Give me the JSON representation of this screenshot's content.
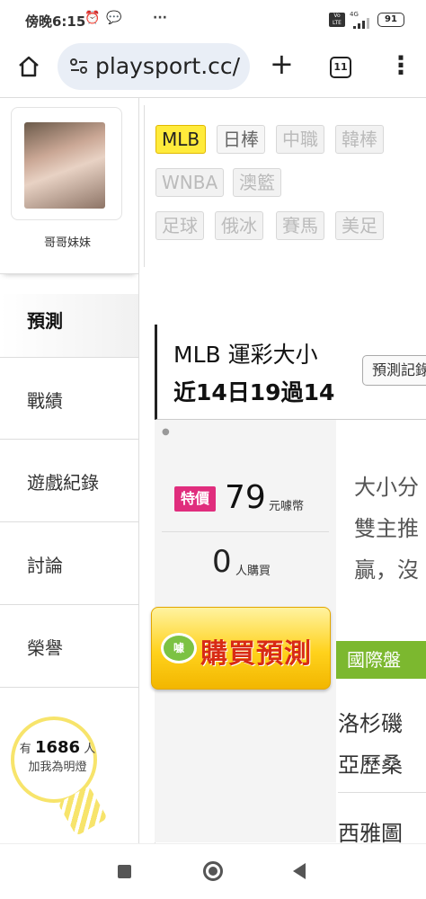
{
  "status_bar": {
    "time": "傍晚6:15",
    "alarm_icon": "alarm-clock-icon",
    "chat_icon": "chat-bubble-icon",
    "more": "···",
    "volte": "Vo LTE",
    "network": "4G",
    "battery": "91"
  },
  "browser": {
    "url": "playsport.cc/",
    "tab_count": "11",
    "plus": "+",
    "menu": "⋮"
  },
  "profile": {
    "username": "哥哥妹妹"
  },
  "sidebar": {
    "items": [
      {
        "label": "預測"
      },
      {
        "label": "戰績"
      },
      {
        "label": "遊戲紀錄"
      },
      {
        "label": "討論"
      },
      {
        "label": "榮譽"
      }
    ]
  },
  "fan_bulb": {
    "prefix": "有",
    "count": "1686",
    "suffix": "人",
    "action": "加我為明燈"
  },
  "sport_tags": {
    "items": [
      "MLB",
      "日棒",
      "中職",
      "韓棒",
      "WNBA",
      "澳籃",
      "足球",
      "俄冰",
      "賽馬",
      "美足"
    ]
  },
  "prediction": {
    "title": "MLB 運彩大小",
    "record": "近14日19過14",
    "record_button": "預測記錄"
  },
  "price": {
    "badge": "特價",
    "value": "79",
    "unit": "元噱幣",
    "buyers": "0",
    "buyers_unit": "人購買",
    "buy_button": "購買預測",
    "buy_icon_text": "噱"
  },
  "description": {
    "line1": "大小分",
    "line2": "雙主推",
    "line3": "贏，沒"
  },
  "market": {
    "label": "國際盤"
  },
  "teams": [
    "洛杉磯",
    "亞歷桑",
    "西雅圖"
  ]
}
